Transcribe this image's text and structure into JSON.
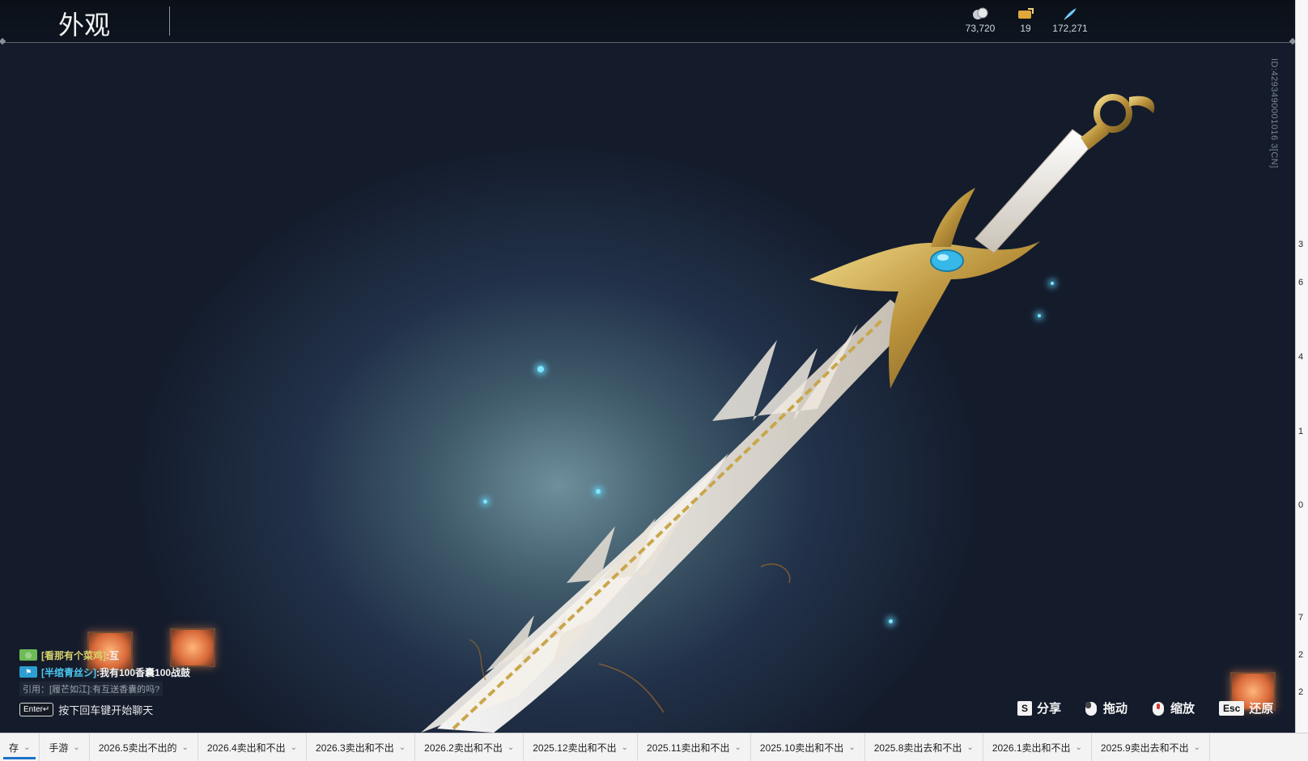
{
  "header": {
    "title": "外观",
    "currencies": [
      {
        "icon": "silver-coins-icon",
        "value": "73,720"
      },
      {
        "icon": "gold-ticket-icon",
        "value": "19"
      },
      {
        "icon": "blue-feather-icon",
        "value": "172,271"
      }
    ],
    "id_text": "ID:4293490001016 3[CN]"
  },
  "chat": {
    "lines": [
      {
        "channel_icon": "world-channel-icon",
        "name": "[看那有个菜鸡]",
        "message": ":互"
      },
      {
        "channel_icon": "guild-channel-icon",
        "name": "[半绾青丝シ]",
        "message": ":我有100香囊100战鼓"
      }
    ],
    "quote": "引用：[履芒如江]:有互送香囊的吗?",
    "hint_key": "Enter↵",
    "hint_text": "按下回车键开始聊天"
  },
  "controls": [
    {
      "key": "S",
      "label": "分享"
    },
    {
      "key": "mouse-left-icon",
      "label": "拖动"
    },
    {
      "key": "mouse-wheel-icon",
      "label": "缩放"
    },
    {
      "key": "Esc",
      "label": "还原"
    }
  ],
  "right_strip": {
    "numbers": [
      "3",
      "6",
      "4",
      "1",
      "0",
      "7",
      "2",
      "2"
    ]
  },
  "tabs": [
    {
      "label": "存",
      "active": true
    },
    {
      "label": "手游",
      "active": false
    },
    {
      "label": "2026.5卖出不出的",
      "active": false
    },
    {
      "label": "2026.4卖出和不出",
      "active": false
    },
    {
      "label": "2026.3卖出和不出",
      "active": false
    },
    {
      "label": "2026.2卖出和不出",
      "active": false
    },
    {
      "label": "2025.12卖出和不出",
      "active": false
    },
    {
      "label": "2025.11卖出和不出",
      "active": false
    },
    {
      "label": "2025.10卖出和不出",
      "active": false
    },
    {
      "label": "2025.8卖出去和不出",
      "active": false
    },
    {
      "label": "2026.1卖出和不出",
      "active": false
    },
    {
      "label": "2025.9卖出去和不出",
      "active": false
    }
  ],
  "colors": {
    "bg_center": "#6f8f9c",
    "bg_edge": "#141c2c",
    "gold": "#c9a64a",
    "feather": "#ece6dc",
    "gem": "#36b8e8",
    "tab_active": "#1a73c8"
  }
}
